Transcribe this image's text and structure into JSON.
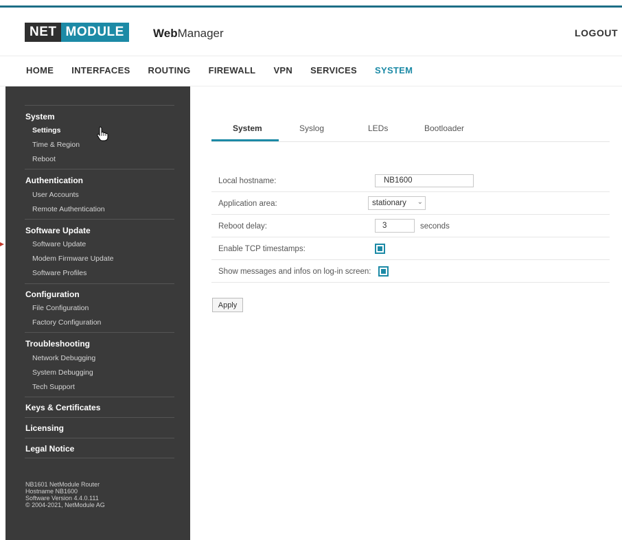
{
  "brand": {
    "logo_part1": "NET",
    "logo_part2": "MODULE",
    "app_bold": "Web",
    "app_light": "Manager",
    "accent_color": "#1c8aa6"
  },
  "header": {
    "logout_label": "LOGOUT"
  },
  "mainnav": {
    "items": [
      "HOME",
      "INTERFACES",
      "ROUTING",
      "FIREWALL",
      "VPN",
      "SERVICES",
      "SYSTEM"
    ],
    "active": "SYSTEM"
  },
  "sidebar": {
    "groups": [
      {
        "label": "System",
        "items": [
          "Settings",
          "Time & Region",
          "Reboot"
        ]
      },
      {
        "label": "Authentication",
        "items": [
          "User Accounts",
          "Remote Authentication"
        ]
      },
      {
        "label": "Software Update",
        "items": [
          "Software Update",
          "Modem Firmware Update",
          "Software Profiles"
        ]
      },
      {
        "label": "Configuration",
        "items": [
          "File Configuration",
          "Factory Configuration"
        ]
      },
      {
        "label": "Troubleshooting",
        "items": [
          "Network Debugging",
          "System Debugging",
          "Tech Support"
        ]
      },
      {
        "label": "Keys & Certificates",
        "items": []
      },
      {
        "label": "Licensing",
        "items": []
      },
      {
        "label": "Legal Notice",
        "items": []
      }
    ],
    "active_item": "Settings",
    "info": [
      "NB1601 NetModule Router",
      "Hostname NB1600",
      "Software Version 4.4.0.111",
      "© 2004-2021, NetModule AG"
    ]
  },
  "tabs": {
    "items": [
      "System",
      "Syslog",
      "LEDs",
      "Bootloader"
    ],
    "active": "System"
  },
  "form": {
    "hostname_label": "Local hostname:",
    "hostname_value": "NB1600",
    "area_label": "Application area:",
    "area_value": "stationary",
    "reboot_label": "Reboot delay:",
    "reboot_value": "3",
    "reboot_unit": "seconds",
    "tcp_label": "Enable TCP timestamps:",
    "tcp_checked": true,
    "messages_label": "Show messages and infos on log-in screen:",
    "messages_checked": true
  },
  "actions": {
    "apply_label": "Apply"
  }
}
